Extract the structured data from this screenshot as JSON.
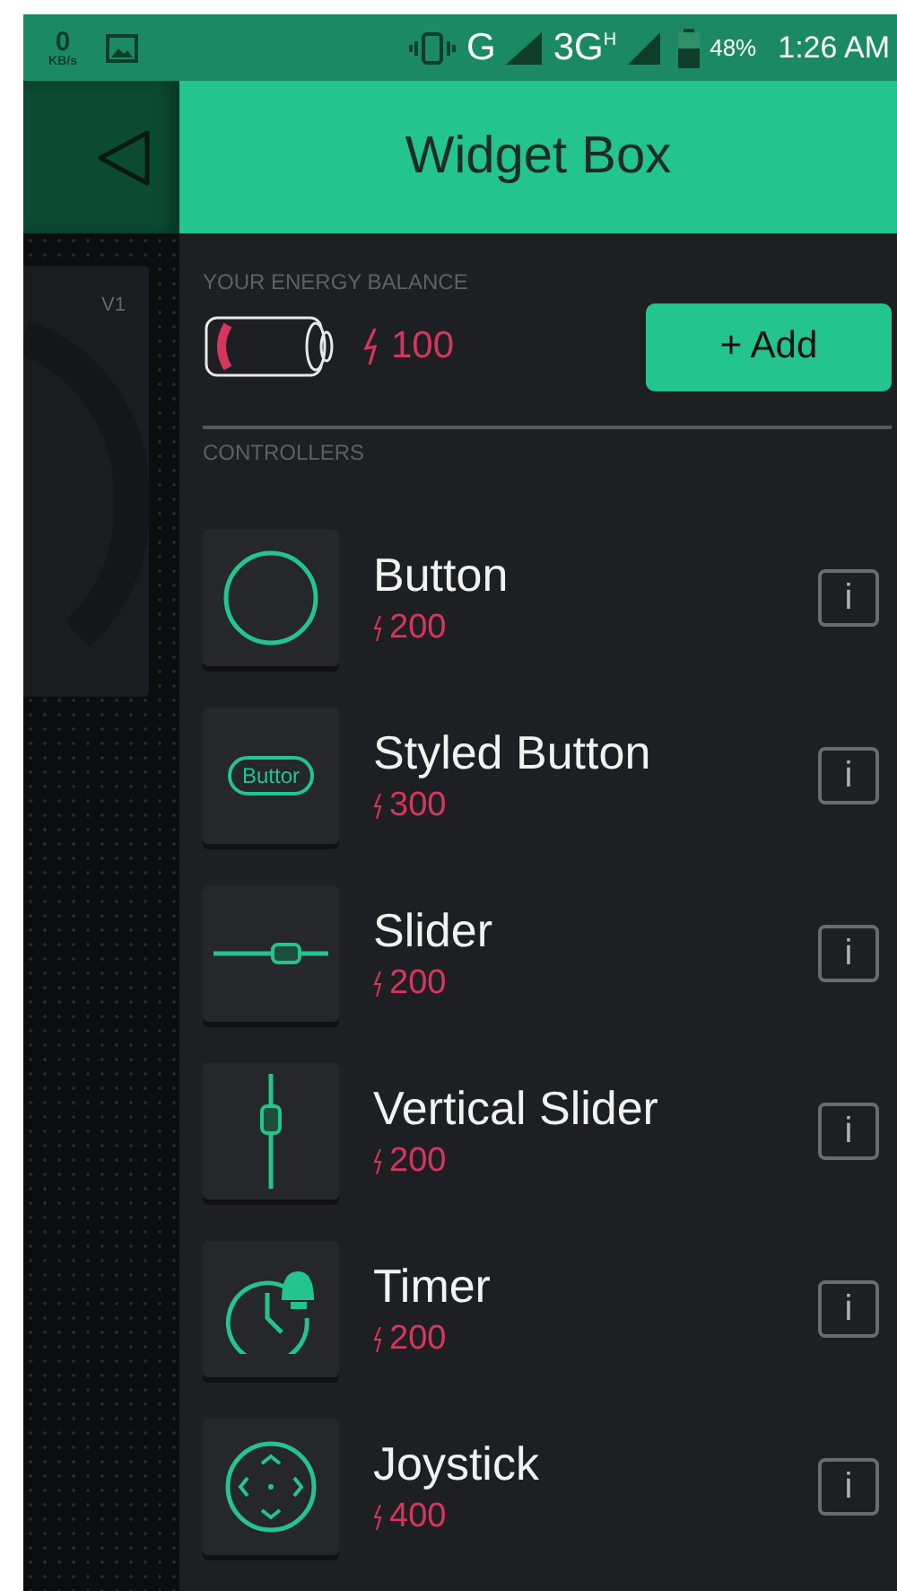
{
  "status_bar": {
    "speed": "0",
    "speed_unit": "KB/s",
    "network": "G",
    "network_2": "3G",
    "network_2_sup": "H",
    "battery": "48%",
    "time": "1:26 AM"
  },
  "background": {
    "widget_label": "V1"
  },
  "header": {
    "title": "Widget Box"
  },
  "energy": {
    "label": "YOUR ENERGY BALANCE",
    "amount": "100",
    "add_button": "+ Add"
  },
  "section": {
    "title": "CONTROLLERS"
  },
  "widgets": [
    {
      "kind": "button",
      "name": "Button",
      "cost": "200",
      "info_button": "i"
    },
    {
      "kind": "styled_button",
      "name": "Styled Button",
      "cost": "300",
      "icon_label": "Buttor",
      "info_button": "i"
    },
    {
      "kind": "slider",
      "name": "Slider",
      "cost": "200",
      "info_button": "i"
    },
    {
      "kind": "vertical_slider",
      "name": "Vertical Slider",
      "cost": "200",
      "info_button": "i"
    },
    {
      "kind": "timer",
      "name": "Timer",
      "cost": "200",
      "info_button": "i"
    },
    {
      "kind": "joystick",
      "name": "Joystick",
      "cost": "400",
      "info_button": "i"
    }
  ]
}
